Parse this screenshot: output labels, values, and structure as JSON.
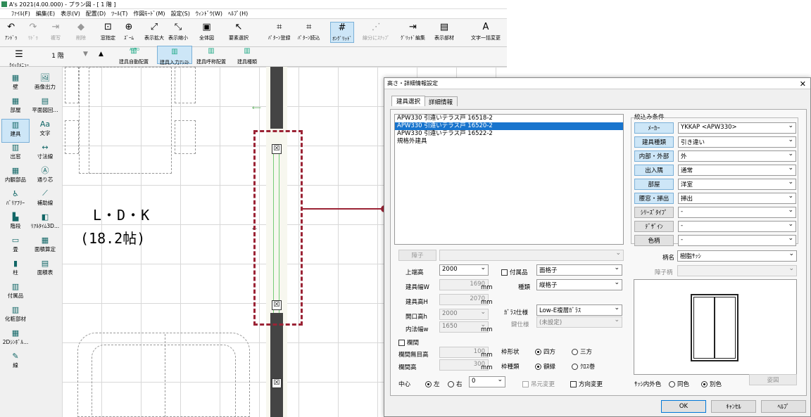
{
  "app": {
    "title": "A's 2021(4.00.000) - プラン図 - [ 1 階 ]"
  },
  "menu": [
    "ﾌｧｲﾙ(F)",
    "編集(E)",
    "表示(V)",
    "配置(D)",
    "ﾂｰﾙ(T)",
    "作図ﾓｰﾄﾞ(M)",
    "設定(S)",
    "ｳｨﾝﾄﾞｳ(W)",
    "ﾍﾙﾌﾟ(H)"
  ],
  "toolbar": [
    {
      "label": "ｱﾝﾄﾞｩ",
      "icon": "undo-icon",
      "glyph": "↶",
      "disabled": false
    },
    {
      "label": "ﾘﾄﾞｩ",
      "icon": "redo-icon",
      "glyph": "↷",
      "disabled": true
    },
    {
      "label": "複写",
      "icon": "copy-icon",
      "glyph": "⇥",
      "disabled": true
    },
    {
      "label": "削除",
      "icon": "eraser-icon",
      "glyph": "◆",
      "disabled": true
    },
    {
      "label": "窓指定",
      "icon": "window-select-icon",
      "glyph": "⊡",
      "disabled": false
    },
    {
      "label": "ｽﾞｰﾑ",
      "icon": "zoom-icon",
      "glyph": "⊕",
      "disabled": false
    },
    {
      "label": "表示拡大",
      "icon": "zoom-in-icon",
      "glyph": "⤢",
      "disabled": false
    },
    {
      "label": "表示縮小",
      "icon": "zoom-out-icon",
      "glyph": "⤡",
      "disabled": false
    },
    {
      "label": "全体図",
      "icon": "fit-view-icon",
      "glyph": "▣",
      "disabled": false
    },
    {
      "label": "要素選択",
      "icon": "cursor-icon",
      "glyph": "↖",
      "disabled": false
    },
    {
      "label": "ﾊﾟﾀｰﾝ登録",
      "icon": "pattern-register-icon",
      "glyph": "⌗",
      "disabled": false
    },
    {
      "label": "ﾊﾟﾀｰﾝ読込",
      "icon": "pattern-load-icon",
      "glyph": "⌗",
      "disabled": false
    },
    {
      "label": "ｵﾝｸﾞﾘｯﾄﾞ",
      "icon": "on-grid-icon",
      "glyph": "#",
      "disabled": false
    },
    {
      "label": "線分にｽﾅｯﾌﾟ",
      "icon": "snap-line-icon",
      "glyph": "⋰",
      "disabled": true
    },
    {
      "label": "ｸﾞﾘｯﾄﾞ編集",
      "icon": "grid-edit-icon",
      "glyph": "⇥",
      "disabled": false
    },
    {
      "label": "表示部材",
      "icon": "display-parts-icon",
      "glyph": "▤",
      "disabled": false
    },
    {
      "label": "文字一括変更",
      "icon": "text-change-icon",
      "glyph": "A",
      "disabled": false
    }
  ],
  "toolbar2": {
    "quick_menu": "ｸｲｯｸﾒﾆｭｰ",
    "floor": "1 階",
    "auto_badge": "AUTO",
    "buttons": [
      "建具自動配置",
      "建具入力ｱｼｽﾄ",
      "建具呼称配置",
      "建具種類"
    ]
  },
  "sidebar": [
    {
      "label": "壁",
      "icon": "wall-icon",
      "glyph": "▦"
    },
    {
      "label": "画像出力",
      "icon": "image-output-icon",
      "glyph": "🖼"
    },
    {
      "label": "部屋",
      "icon": "room-icon",
      "glyph": "▦"
    },
    {
      "label": "平面図回...",
      "icon": "plan-rotate-icon",
      "glyph": "▤"
    },
    {
      "label": "建具",
      "icon": "fitting-icon",
      "glyph": "▥"
    },
    {
      "label": "文字",
      "icon": "text-icon",
      "glyph": "Aa"
    },
    {
      "label": "出窓",
      "icon": "bay-window-icon",
      "glyph": "▥"
    },
    {
      "label": "寸法線",
      "icon": "dimension-icon",
      "glyph": "↔"
    },
    {
      "label": "内観部品",
      "icon": "interior-parts-icon",
      "glyph": "▦"
    },
    {
      "label": "通り芯",
      "icon": "grid-axis-icon",
      "glyph": "Ⓐ"
    },
    {
      "label": "ﾊﾞﾘｱﾌﾘｰ",
      "icon": "barrier-free-icon",
      "glyph": "♿"
    },
    {
      "label": "補助線",
      "icon": "guide-line-icon",
      "glyph": "⟋"
    },
    {
      "label": "階段",
      "icon": "stairs-icon",
      "glyph": "▙"
    },
    {
      "label": "ﾘｱﾙﾀｲﾑ3D...",
      "icon": "realtime-3d-icon",
      "glyph": "◧"
    },
    {
      "label": "畳",
      "icon": "tatami-icon",
      "glyph": "▭"
    },
    {
      "label": "面積算定",
      "icon": "area-calc-icon",
      "glyph": "▦"
    },
    {
      "label": "柱",
      "icon": "column-icon",
      "glyph": "▮"
    },
    {
      "label": "面積表",
      "icon": "area-table-icon",
      "glyph": "▤"
    },
    {
      "label": "付属品",
      "icon": "accessory-icon",
      "glyph": "▥"
    },
    {
      "label": "化粧部材",
      "icon": "trim-icon",
      "glyph": "▥"
    },
    {
      "label": "2Dｼﾝﾎﾞﾙ...",
      "icon": "2d-symbol-icon",
      "glyph": "▦"
    },
    {
      "label": "線",
      "icon": "line-icon",
      "glyph": "✎"
    }
  ],
  "canvas": {
    "room_name": "L・D・K",
    "room_size": "(18.2帖)"
  },
  "dialog": {
    "title": "高さ・詳細情報設定",
    "tabs": [
      "建具選択",
      "詳細情報"
    ],
    "list": [
      "APW330 引違いテラス戸 16518-2",
      "APW330 引違いテラス戸 16520-2",
      "APW330 引違いテラス戸 16522-2",
      "規格外建具"
    ],
    "filter": {
      "title": "絞込み条件",
      "rows": [
        {
          "label": "ﾒｰｶｰ",
          "value": "YKKAP <APW330>",
          "blue": true
        },
        {
          "label": "建具種類",
          "value": "引き違い",
          "blue": true
        },
        {
          "label": "内部・外部",
          "value": "外",
          "blue": true
        },
        {
          "label": "出入隅",
          "value": "通常",
          "blue": true
        },
        {
          "label": "部屋",
          "value": "洋室",
          "blue": true
        },
        {
          "label": "腰窓・掃出",
          "value": "掃出",
          "blue": true
        },
        {
          "label": "ｼﾘｰｽﾞﾀｲﾌﾟ",
          "value": "-",
          "blue": false
        },
        {
          "label": "ﾃﾞｻﾞｲﾝ",
          "value": "-",
          "blue": false
        },
        {
          "label": "色柄",
          "value": "-",
          "blue": false
        }
      ]
    },
    "shoji_button": "障子",
    "pattern_label": "柄名",
    "pattern_value": "樹脂ｻｯｼ",
    "shoji_pattern_label": "障子柄",
    "fields": {
      "top_height_label": "上端高",
      "top_height": "2000",
      "width_label": "建具幅W",
      "width": "1690",
      "height_label": "建具高H",
      "height": "2070",
      "open_h_label": "開口高h",
      "open_h": "2000",
      "inner_w_label": "内法幅w",
      "inner_w": "1650",
      "unit": "mm",
      "accessory_label": "付属品",
      "accessory": "面格子",
      "type_label": "種類",
      "type": "縦格子",
      "glass_label": "ｶﾞﾗｽ仕様",
      "glass": "Low-E複層ｶﾞﾗｽ",
      "lock_label": "鍵仕様",
      "lock": "(未設定)",
      "transom_label": "欄間",
      "transom_plain_label": "欄間無目高",
      "transom_plain": "100",
      "transom_h_label": "欄間高",
      "transom_h": "300",
      "frame_shape_label": "枠形状",
      "frame_shape_opts": [
        "四方",
        "三方"
      ],
      "frame_type_label": "枠種類",
      "frame_type_opts": [
        "額縁",
        "ｸﾛｽ巻"
      ],
      "center_label": "中心",
      "center_opts": [
        "左",
        "右"
      ],
      "center_value": "0",
      "hang_label": "吊元変更",
      "dir_label": "方向変更",
      "sash_color_label": "ｻｯｼ内外色",
      "sash_color_opts": [
        "同色",
        "別色"
      ],
      "elev_button": "姿図"
    },
    "buttons": {
      "ok": "OK",
      "cancel": "ｷｬﾝｾﾙ",
      "help": "ﾍﾙﾌﾟ"
    }
  },
  "colors": {
    "highlight": "#1874cd",
    "callout": "#9b2335",
    "wall": "#444444"
  }
}
